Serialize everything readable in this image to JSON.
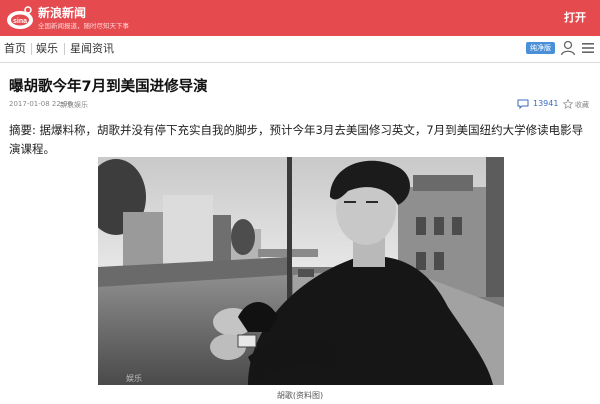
{
  "banner": {
    "app_title": "新浪新闻",
    "app_subtitle": "全国新闻报道，随时尽知天下事",
    "open_label": "打开",
    "logo_text": "sina"
  },
  "nav": {
    "home": "首页",
    "ent": "娱乐",
    "star": "星闻资讯",
    "badge": "纯净版"
  },
  "article": {
    "title": "曝胡歌今年7月到美国进修导演",
    "time": "2017-01-08 22:06",
    "source": "新浪娱乐",
    "comments": "13941",
    "favorite_label": "收藏",
    "summary": "摘要: 据爆料称，胡歌并没有停下充实自我的脚步，预计今年3月去美国修习英文，7月到美国纽约大学修读电影导演课程。",
    "photo_watermark": "娱乐",
    "caption": "胡歌(资料图)"
  },
  "colors": {
    "brand_red": "#e54a4f",
    "link_blue": "#3b6bbf",
    "badge_blue": "#4a90d9"
  }
}
